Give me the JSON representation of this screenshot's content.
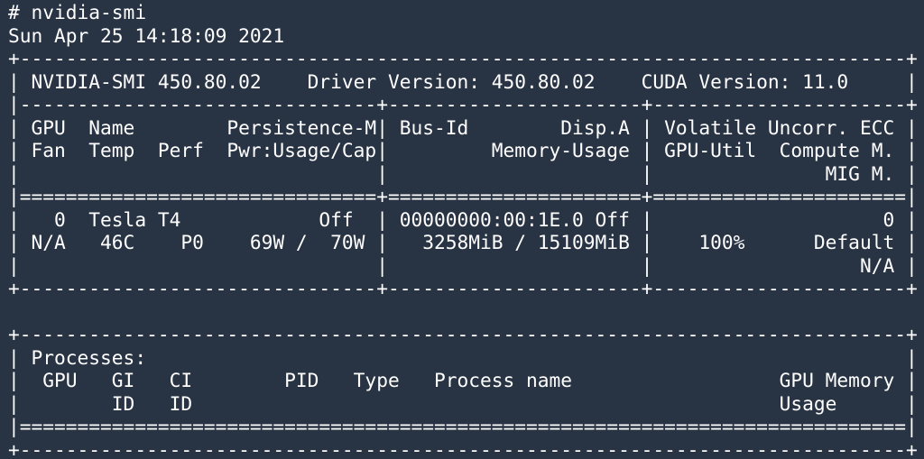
{
  "terminal": {
    "lines": [
      "# nvidia-smi",
      "Sun Apr 25 14:18:09 2021",
      "+-----------------------------------------------------------------------------+",
      "| NVIDIA-SMI 450.80.02    Driver Version: 450.80.02    CUDA Version: 11.0     |",
      "|-------------------------------+----------------------+----------------------+",
      "| GPU  Name        Persistence-M| Bus-Id        Disp.A | Volatile Uncorr. ECC |",
      "| Fan  Temp  Perf  Pwr:Usage/Cap|         Memory-Usage | GPU-Util  Compute M. |",
      "|                               |                      |               MIG M. |",
      "|===============================+======================+======================|",
      "|   0  Tesla T4            Off  | 00000000:00:1E.0 Off |                    0 |",
      "| N/A   46C    P0    69W /  70W |   3258MiB / 15109MiB |    100%      Default |",
      "|                               |                      |                  N/A |",
      "+-------------------------------+----------------------+----------------------+",
      "",
      "+-----------------------------------------------------------------------------+",
      "| Processes:                                                                  |",
      "|  GPU   GI   CI        PID   Type   Process name                  GPU Memory |",
      "|        ID   ID                                                   Usage      |",
      "|=============================================================================|",
      "+-----------------------------------------------------------------------------+"
    ]
  }
}
